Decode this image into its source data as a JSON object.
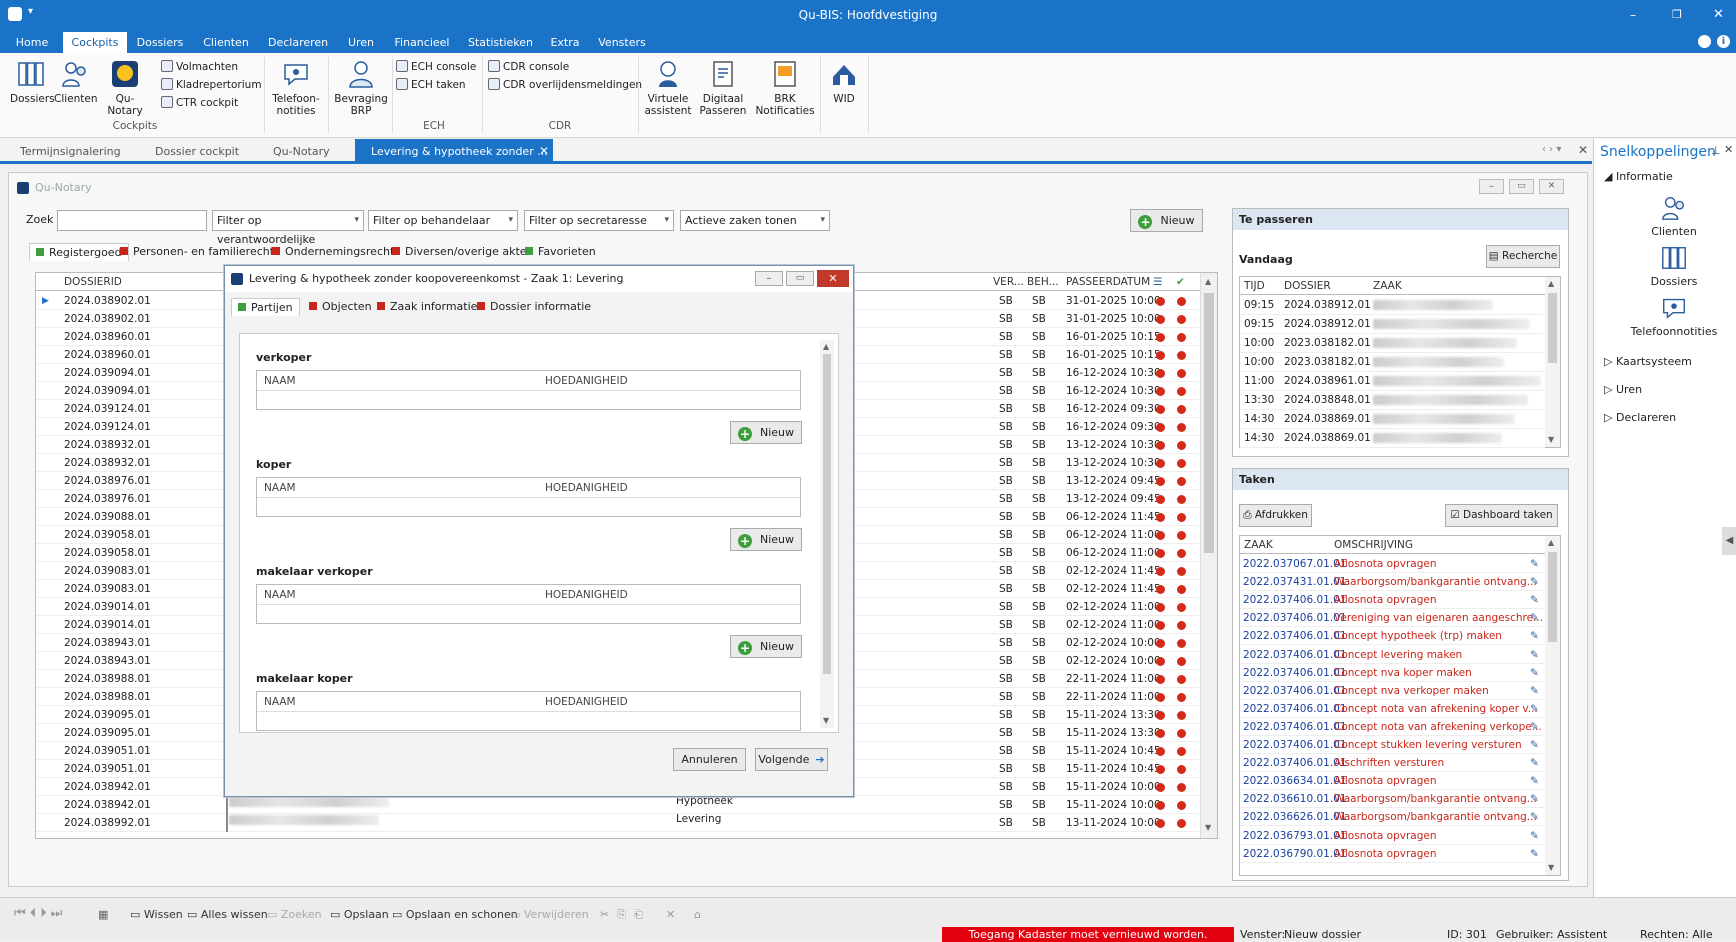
{
  "app": {
    "title": "Qu-BIS: Hoofdvestiging"
  },
  "menu": [
    "Home",
    "Cockpits",
    "Dossiers",
    "Clienten",
    "Declareren",
    "Uren",
    "Financieel",
    "Statistieken",
    "Extra",
    "Vensters"
  ],
  "ribbon": {
    "big1": [
      {
        "label": "Dossiers",
        "icon": "dossiers-icon"
      },
      {
        "label": "Clienten",
        "icon": "clienten-icon"
      },
      {
        "label": "Qu-Notary",
        "icon": "qu-notary-icon"
      }
    ],
    "small1": [
      "Volmachten",
      "Kladrepertorium",
      "CTR cockpit"
    ],
    "group1": "Cockpits",
    "telefoon": [
      "Telefoon-",
      "notities"
    ],
    "bevraging": [
      "Bevraging",
      "BRP"
    ],
    "ech": [
      "ECH console",
      "ECH taken"
    ],
    "group_ech": "ECH",
    "cdr": [
      "CDR console",
      "CDR overlijdensmeldingen"
    ],
    "group_cdr": "CDR",
    "virtueel": [
      "Virtuele",
      "assistent"
    ],
    "digitaal": [
      "Digitaal",
      "Passeren"
    ],
    "brk": [
      "BRK",
      "Notificaties"
    ],
    "wid": "WID"
  },
  "doctabs": [
    "Termijnsignalering",
    "Dossier cockpit",
    "Qu-Notary",
    "Levering & hypotheek zonder ..."
  ],
  "window": {
    "title": "Qu-Notary",
    "zoek_label": "Zoek",
    "zoek_value": "",
    "filters": [
      "Filter op verantwoordelijke",
      "Filter op behandelaar",
      "Filter op secretaresse",
      "Actieve zaken tonen"
    ],
    "nieuw": "Nieuw",
    "cat_tabs": [
      {
        "label": "Registergoed",
        "color": "#3e9e3e"
      },
      {
        "label": "Personen- en familierecht",
        "color": "#c8261a"
      },
      {
        "label": "Ondernemingsrecht",
        "color": "#c8261a"
      },
      {
        "label": "Diversen/overige akten",
        "color": "#c8261a"
      },
      {
        "label": "Favorieten",
        "color": "#3e9e3e"
      }
    ],
    "columns": {
      "dossierid": "DOSSIERID",
      "ver": "VER...",
      "beh": "BEH...",
      "passeer": "PASSEERDATUM"
    },
    "rows": [
      [
        "2024.038902.01",
        "SB",
        "SB",
        "31-01-2025 10:00"
      ],
      [
        "2024.038902.01",
        "SB",
        "SB",
        "31-01-2025 10:00"
      ],
      [
        "2024.038960.01",
        "SB",
        "SB",
        "16-01-2025 10:15"
      ],
      [
        "2024.038960.01",
        "SB",
        "SB",
        "16-01-2025 10:15"
      ],
      [
        "2024.039094.01",
        "SB",
        "SB",
        "16-12-2024 10:30"
      ],
      [
        "2024.039094.01",
        "SB",
        "SB",
        "16-12-2024 10:30"
      ],
      [
        "2024.039124.01",
        "SB",
        "SB",
        "16-12-2024 09:30"
      ],
      [
        "2024.039124.01",
        "SB",
        "SB",
        "16-12-2024 09:30"
      ],
      [
        "2024.038932.01",
        "SB",
        "SB",
        "13-12-2024 10:30"
      ],
      [
        "2024.038932.01",
        "SB",
        "SB",
        "13-12-2024 10:30"
      ],
      [
        "2024.038976.01",
        "SB",
        "SB",
        "13-12-2024 09:45"
      ],
      [
        "2024.038976.01",
        "SB",
        "SB",
        "13-12-2024 09:45"
      ],
      [
        "2024.039088.01",
        "SB",
        "SB",
        "06-12-2024 11:45"
      ],
      [
        "2024.039058.01",
        "SB",
        "SB",
        "06-12-2024 11:00"
      ],
      [
        "2024.039058.01",
        "SB",
        "SB",
        "06-12-2024 11:00"
      ],
      [
        "2024.039083.01",
        "SB",
        "SB",
        "02-12-2024 11:45"
      ],
      [
        "2024.039083.01",
        "SB",
        "SB",
        "02-12-2024 11:45"
      ],
      [
        "2024.039014.01",
        "SB",
        "SB",
        "02-12-2024 11:00"
      ],
      [
        "2024.039014.01",
        "SB",
        "SB",
        "02-12-2024 11:00"
      ],
      [
        "2024.038943.01",
        "SB",
        "SB",
        "02-12-2024 10:00"
      ],
      [
        "2024.038943.01",
        "SB",
        "SB",
        "02-12-2024 10:00"
      ],
      [
        "2024.038988.01",
        "SB",
        "SB",
        "22-11-2024 11:00"
      ],
      [
        "2024.038988.01",
        "SB",
        "SB",
        "22-11-2024 11:00"
      ],
      [
        "2024.039095.01",
        "SB",
        "SB",
        "15-11-2024 13:30"
      ],
      [
        "2024.039095.01",
        "SB",
        "SB",
        "15-11-2024 13:30"
      ],
      [
        "2024.039051.01",
        "SB",
        "SB",
        "15-11-2024 10:45"
      ],
      [
        "2024.039051.01",
        "SB",
        "SB",
        "15-11-2024 10:45"
      ],
      [
        "2024.038942.01",
        "SB",
        "SB",
        "15-11-2024 10:00"
      ],
      [
        "2024.038942.01",
        "SB",
        "SB",
        "15-11-2024 10:00"
      ],
      [
        "2024.038992.01",
        "SB",
        "SB",
        "13-11-2024 10:00"
      ]
    ],
    "below_modal": [
      "Hypotheek",
      "Levering"
    ]
  },
  "modal": {
    "title": "Levering & hypotheek zonder koopovereenkomst - Zaak 1: Levering",
    "tabs": [
      {
        "label": "Partijen",
        "color": "#3e9e3e"
      },
      {
        "label": "Objecten",
        "color": "#c8261a"
      },
      {
        "label": "Zaak informatie",
        "color": "#c8261a"
      },
      {
        "label": "Dossier informatie",
        "color": "#c8261a"
      }
    ],
    "sections": [
      "verkoper",
      "koper",
      "makelaar verkoper",
      "makelaar koper"
    ],
    "col_naam": "NAAM",
    "col_hoed": "HOEDANIGHEID",
    "nieuw": "Nieuw",
    "annuleren": "Annuleren",
    "volgende": "Volgende"
  },
  "tepasseren": {
    "title": "Te passeren",
    "vandaag": "Vandaag",
    "recherche": "Recherche",
    "cols": [
      "TIJD",
      "DOSSIER",
      "ZAAK"
    ],
    "rows": [
      [
        "09:15",
        "2024.038912.01"
      ],
      [
        "09:15",
        "2024.038912.01"
      ],
      [
        "10:00",
        "2023.038182.01"
      ],
      [
        "10:00",
        "2023.038182.01"
      ],
      [
        "11:00",
        "2024.038961.01"
      ],
      [
        "13:30",
        "2024.038848.01"
      ],
      [
        "14:30",
        "2024.038869.01"
      ],
      [
        "14:30",
        "2024.038869.01"
      ]
    ]
  },
  "taken": {
    "title": "Taken",
    "afdrukken": "Afdrukken",
    "dashboard": "Dashboard taken",
    "cols": [
      "ZAAK",
      "OMSCHRIJVING"
    ],
    "rows": [
      [
        "2022.037067.01.01",
        "Aflosnota opvragen"
      ],
      [
        "2022.037431.01.01",
        "Waarborgsom/bankgarantie ontvang..."
      ],
      [
        "2022.037406.01.01",
        "Aflosnota opvragen"
      ],
      [
        "2022.037406.01.01",
        "Vereniging van eigenaren aangeschre..."
      ],
      [
        "2022.037406.01.01",
        "Concept hypotheek (trp) maken"
      ],
      [
        "2022.037406.01.01",
        "Concept levering maken"
      ],
      [
        "2022.037406.01.01",
        "Concept nva koper maken"
      ],
      [
        "2022.037406.01.01",
        "Concept nva verkoper maken"
      ],
      [
        "2022.037406.01.01",
        "Concept nota van afrekening koper v..."
      ],
      [
        "2022.037406.01.01",
        "Concept nota van afrekening verkope..."
      ],
      [
        "2022.037406.01.01",
        "Concept stukken levering versturen"
      ],
      [
        "2022.037406.01.01",
        "Afschriften versturen"
      ],
      [
        "2022.036634.01.01",
        "Aflosnota opvragen"
      ],
      [
        "2022.036610.01.01",
        "Waarborgsom/bankgarantie ontvang..."
      ],
      [
        "2022.036626.01.01",
        "Waarborgsom/bankgarantie ontvang..."
      ],
      [
        "2022.036793.01.01",
        "Aflosnota opvragen"
      ],
      [
        "2022.036790.01.01",
        "Aflosnota opvragen"
      ]
    ]
  },
  "snelkoppelingen": {
    "title": "Snelkoppelingen",
    "informatie": "Informatie",
    "links": [
      "Clienten",
      "Dossiers",
      "Telefoonnotities"
    ],
    "groups": [
      "Kaartsysteem",
      "Uren",
      "Declareren"
    ]
  },
  "statusbar": {
    "tools": [
      "Wissen",
      "Alles wissen",
      "Zoeken",
      "Opslaan",
      "Opslaan en schonen",
      "Verwijderen"
    ],
    "warning": "Toegang Kadaster moet vernieuwd worden.",
    "venster_label": "Venster:",
    "venster": "Nieuw dossier",
    "id": "ID: 301",
    "gebruiker": "Gebruiker: Assistent",
    "rechten": "Rechten: Alle"
  },
  "colors": {
    "accent": "#1a73c7",
    "warning": "#e3000f",
    "status_red": "#d42a1a",
    "status_green": "#3e9e3e"
  }
}
